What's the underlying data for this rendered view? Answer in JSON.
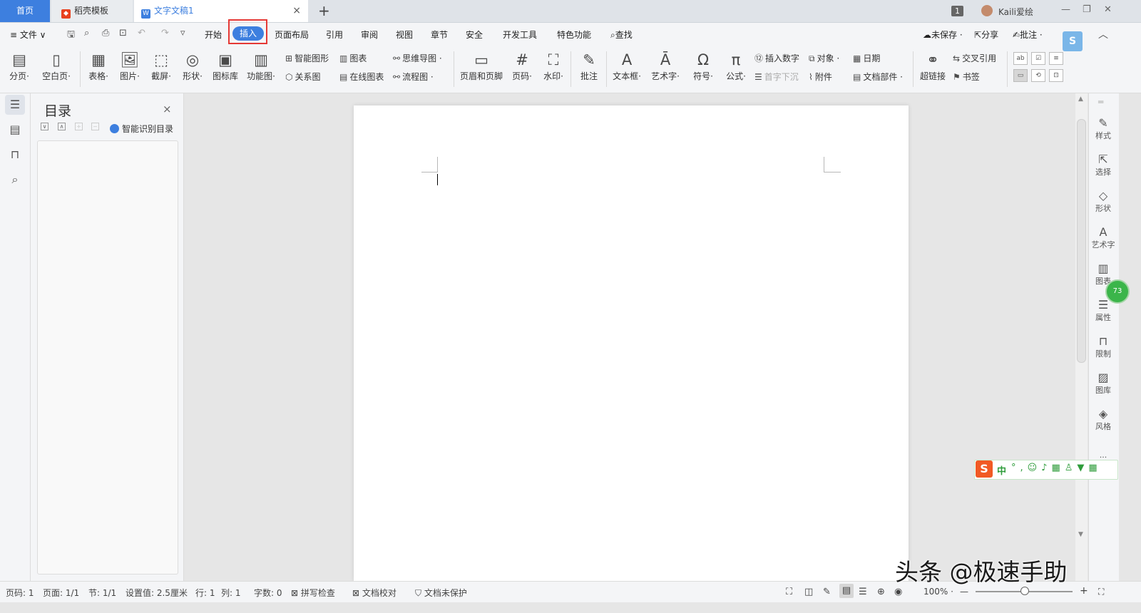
{
  "tabs": {
    "home": "首页",
    "docer": "稻壳模板",
    "doc": "文字文稿1",
    "close": "×",
    "new": "+",
    "count": "1"
  },
  "user": {
    "name": "Kaili爱绘"
  },
  "window_controls": [
    "—",
    "❐",
    "✕"
  ],
  "menu": {
    "file": "≡ 文件 ∨",
    "items": [
      "开始",
      "插入",
      "页面布局",
      "引用",
      "审阅",
      "视图",
      "章节",
      "安全",
      "开发工具",
      "特色功能"
    ],
    "search": "查找",
    "right": [
      "未保存 ·",
      "分享",
      "批注 ·"
    ]
  },
  "ribbon": {
    "big": [
      {
        "glyph": "▤",
        "label": "分页·"
      },
      {
        "glyph": "▯",
        "label": "空白页·"
      },
      {
        "glyph": "▦",
        "label": "表格·"
      },
      {
        "glyph": "🖼",
        "label": "图片·"
      },
      {
        "glyph": "⬚",
        "label": "截屏·"
      },
      {
        "glyph": "◎",
        "label": "形状·"
      },
      {
        "glyph": "▣",
        "label": "图标库"
      },
      {
        "glyph": "▥",
        "label": "功能图·"
      },
      {
        "glyph": "▭",
        "label": "页眉和页脚"
      },
      {
        "glyph": "#",
        "label": "页码·"
      },
      {
        "glyph": "⛶",
        "label": "水印·"
      },
      {
        "glyph": "✎",
        "label": "批注"
      },
      {
        "glyph": "A",
        "label": "文本框·"
      },
      {
        "glyph": "Ā",
        "label": "艺术字·"
      },
      {
        "glyph": "Ω",
        "label": "符号·"
      },
      {
        "glyph": "π",
        "label": "公式·"
      },
      {
        "glyph": "⚭",
        "label": "超链接"
      }
    ],
    "small": {
      "smart_graphic": "智能图形",
      "chart": "图表",
      "mind_map": "思维导图 ·",
      "relation": "关系图",
      "online_chart": "在线图表",
      "flowchart": "流程图 ·",
      "insert_number": "插入数字",
      "object": "对象 ·",
      "date": "日期",
      "drop_cap": "首字下沉",
      "attachment": "附件",
      "doc_parts": "文档部件 ·",
      "cross_ref": "交叉引用",
      "bookmark": "书签"
    }
  },
  "toc": {
    "title": "目录",
    "close": "×",
    "smart": "智能识别目录"
  },
  "right_panel": [
    "样式",
    "选择",
    "形状",
    "艺术字",
    "图表",
    "属性",
    "限制",
    "图库",
    "风格",
    "···"
  ],
  "status": {
    "page": "页码: 1",
    "pages": "页面: 1/1",
    "section": "节: 1/1",
    "setting": "设置值: 2.5厘米",
    "row": "行: 1",
    "col": "列: 1",
    "words": "字数: 0",
    "spell": "拼写检查",
    "proof": "文档校对",
    "protect": "文档未保护",
    "zoom": "100% ·",
    "zoom_minus": "—",
    "zoom_plus": "+"
  },
  "ime": {
    "logo": "S",
    "lang": "中",
    "badge": "73"
  },
  "watermark": "头条 @极速手助"
}
